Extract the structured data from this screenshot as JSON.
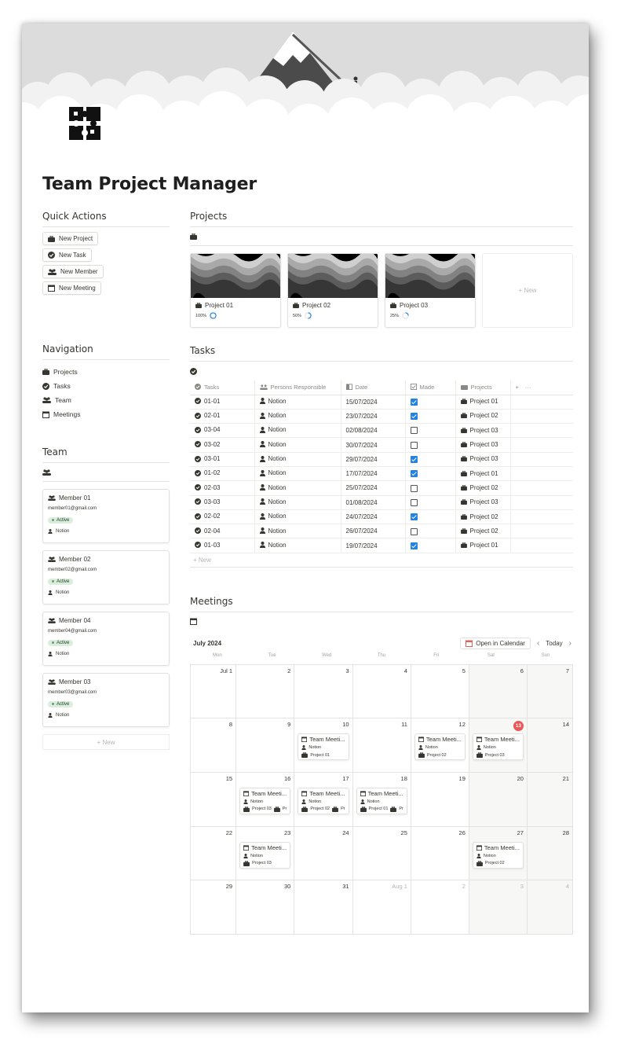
{
  "title": "Team Project Manager",
  "quick_actions": {
    "heading": "Quick Actions",
    "buttons": [
      "New Project",
      "New Task",
      "New Member",
      "New Meeting"
    ]
  },
  "navigation": {
    "heading": "Navigation",
    "items": [
      "Projects",
      "Tasks",
      "Team",
      "Meetings"
    ]
  },
  "team": {
    "heading": "Team",
    "new_label": "+ New",
    "members": [
      {
        "name": "Member 01",
        "email": "member01@gmail.com",
        "status": "Active",
        "person": "Notion"
      },
      {
        "name": "Member 02",
        "email": "member02@gmail.com",
        "status": "Active",
        "person": "Notion"
      },
      {
        "name": "Member 04",
        "email": "member04@gmail.com",
        "status": "Active",
        "person": "Notion"
      },
      {
        "name": "Member 03",
        "email": "member03@gmail.com",
        "status": "Active",
        "person": "Notion"
      }
    ]
  },
  "projects": {
    "heading": "Projects",
    "new_label": "+ New",
    "cards": [
      {
        "name": "Project 01",
        "progress_label": "100%",
        "progress": 1.0
      },
      {
        "name": "Project 02",
        "progress_label": "50%",
        "progress": 0.5
      },
      {
        "name": "Project 03",
        "progress_label": "25%",
        "progress": 0.25
      }
    ]
  },
  "tasks": {
    "heading": "Tasks",
    "new_label": "+ New",
    "columns": [
      "Tasks",
      "Persons Responsible",
      "Date",
      "Made",
      "Projects"
    ],
    "add_col": "+",
    "more": "···",
    "rows": [
      {
        "task": "01-01",
        "person": "Notion",
        "date": "15/07/2024",
        "made": true,
        "project": "Project 01"
      },
      {
        "task": "02-01",
        "person": "Notion",
        "date": "23/07/2024",
        "made": true,
        "project": "Project 02"
      },
      {
        "task": "03-04",
        "person": "Notion",
        "date": "02/08/2024",
        "made": false,
        "project": "Project 03"
      },
      {
        "task": "03-02",
        "person": "Notion",
        "date": "30/07/2024",
        "made": false,
        "project": "Project 03"
      },
      {
        "task": "03-01",
        "person": "Notion",
        "date": "29/07/2024",
        "made": true,
        "project": "Project 03"
      },
      {
        "task": "01-02",
        "person": "Notion",
        "date": "17/07/2024",
        "made": true,
        "project": "Project 01"
      },
      {
        "task": "02-03",
        "person": "Notion",
        "date": "25/07/2024",
        "made": false,
        "project": "Project 02"
      },
      {
        "task": "03-03",
        "person": "Notion",
        "date": "01/08/2024",
        "made": false,
        "project": "Project 03"
      },
      {
        "task": "02-02",
        "person": "Notion",
        "date": "24/07/2024",
        "made": true,
        "project": "Project 02"
      },
      {
        "task": "02-04",
        "person": "Notion",
        "date": "26/07/2024",
        "made": false,
        "project": "Project 02"
      },
      {
        "task": "01-03",
        "person": "Notion",
        "date": "19/07/2024",
        "made": true,
        "project": "Project 01"
      }
    ]
  },
  "meetings": {
    "heading": "Meetings",
    "month": "July 2024",
    "open_in_calendar": "Open in Calendar",
    "today_label": "Today",
    "prev": "‹",
    "next": "›",
    "weekdays": [
      "Mon",
      "Tue",
      "Wed",
      "Thu",
      "Fri",
      "Sat",
      "Sun"
    ],
    "days": [
      "Jul 1",
      "2",
      "3",
      "4",
      "5",
      "6",
      "7",
      "8",
      "9",
      "10",
      "11",
      "12",
      "13",
      "14",
      "15",
      "16",
      "17",
      "18",
      "19",
      "20",
      "21",
      "22",
      "23",
      "24",
      "25",
      "26",
      "27",
      "28",
      "29",
      "30",
      "31",
      "Aug 1",
      "2",
      "3",
      "4"
    ],
    "muted_from": 31,
    "today_index": 12,
    "events": [
      {
        "day_index": 9,
        "title": "Team Meeti...",
        "person": "Notion",
        "project": "Project 01"
      },
      {
        "day_index": 11,
        "title": "Team Meeti...",
        "person": "Notion",
        "project": "Project 02"
      },
      {
        "day_index": 12,
        "title": "Team Meeti...",
        "person": "Notion",
        "project": "Project 03"
      },
      {
        "day_index": 15,
        "title": "Team Meeti...",
        "person": "Notion",
        "project": "Project 03",
        "extra": "Pr"
      },
      {
        "day_index": 16,
        "title": "Team Meeti...",
        "person": "Notion",
        "project": "Project 02",
        "extra": "Pr"
      },
      {
        "day_index": 17,
        "title": "Team Meeti...",
        "person": "Notion",
        "project": "Project 01",
        "extra": "Pr"
      },
      {
        "day_index": 22,
        "title": "Team Meeti...",
        "person": "Notion",
        "project": "Project 03"
      },
      {
        "day_index": 26,
        "title": "Team Meeti...",
        "person": "Notion",
        "project": "Project 02"
      }
    ]
  },
  "colors": {
    "accent_blue": "#2383e2",
    "today_red": "#eb5757",
    "active_green": "#dbeddb",
    "calendar_red": "#e16259"
  }
}
